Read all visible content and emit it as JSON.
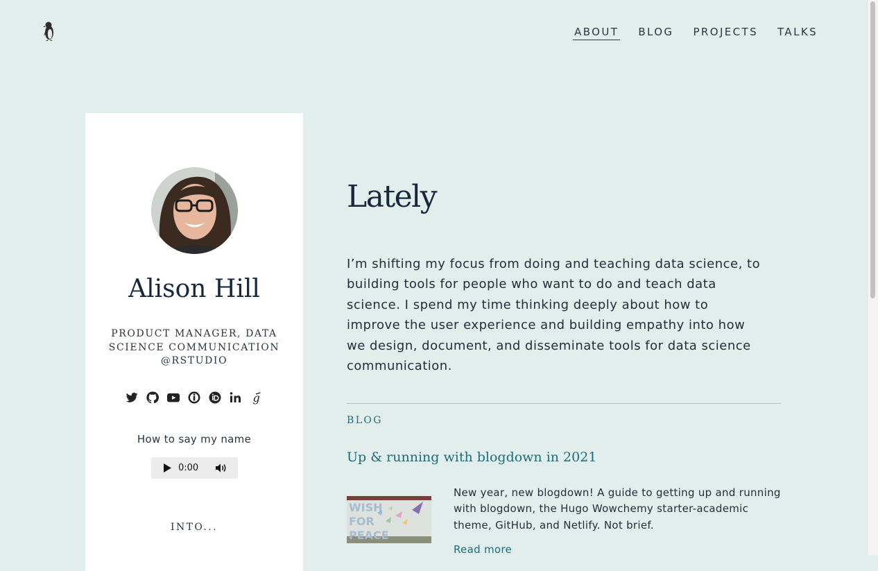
{
  "nav": {
    "items": [
      {
        "label": "ABOUT",
        "active": true
      },
      {
        "label": "BLOG",
        "active": false
      },
      {
        "label": "PROJECTS",
        "active": false
      },
      {
        "label": "TALKS",
        "active": false
      }
    ]
  },
  "profile": {
    "name": "Alison Hill",
    "role": "PRODUCT MANAGER, DATA SCIENCE COMMUNICATION @RSTUDIO",
    "social_icons": [
      "twitter-icon",
      "github-icon",
      "youtube-icon",
      "impactstory-icon",
      "orcid-icon",
      "linkedin-icon",
      "google-scholar-icon"
    ],
    "say_name_label": "How to say my name",
    "audio_time": "0:00",
    "into_label": "INTO..."
  },
  "main": {
    "heading": "Lately",
    "intro": "I’m shifting my focus from doing and teaching data science, to building tools for people who want to do and teach data science. I spend my time thinking deeply about how to improve the user experience and building empathy into how we design, document, and disseminate tools for data science communication.",
    "section_label": "BLOG",
    "post": {
      "title": "Up & running with blogdown in 2021",
      "summary": "New year, new blogdown! A guide to getting up and running with blogdown, the Hugo Wowchemy starter-academic theme, GitHub, and Netlify. Not brief.",
      "read_more": "Read more",
      "thumbnail_text": [
        "WISH",
        "FOR",
        "PEACE"
      ]
    }
  },
  "colors": {
    "background": "#e2eeec",
    "accent": "#1f6b7b",
    "heading": "#17283d"
  }
}
